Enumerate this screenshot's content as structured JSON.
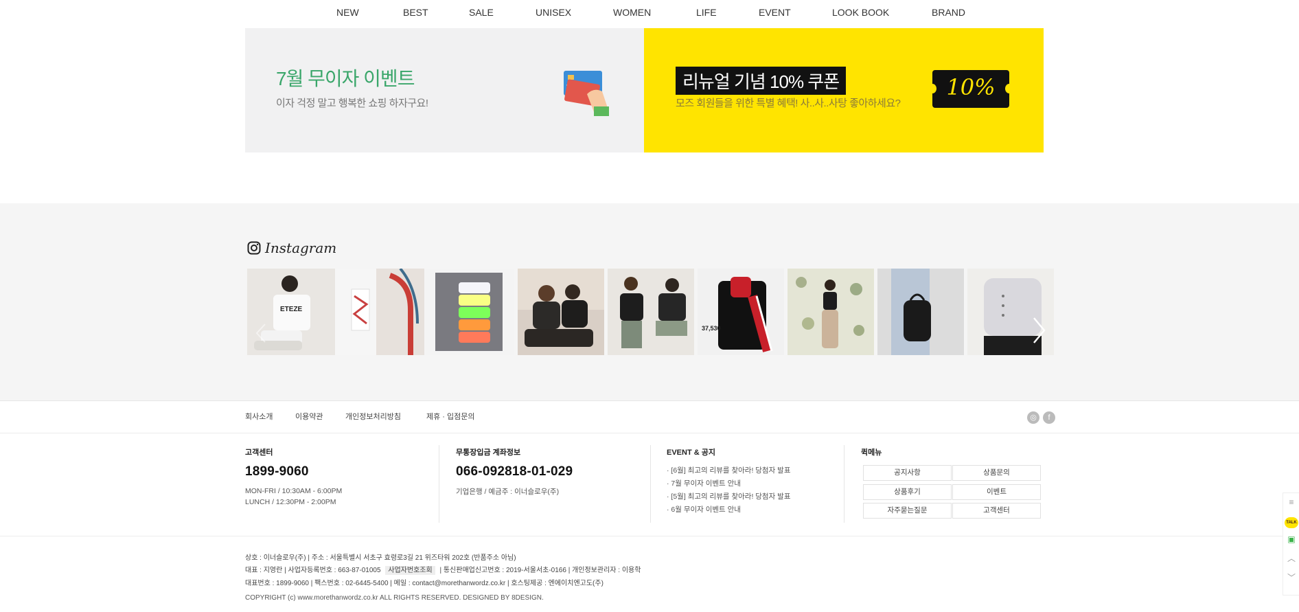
{
  "nav": {
    "items": [
      "NEW",
      "BEST",
      "SALE",
      "UNISEX",
      "WOMEN",
      "LIFE",
      "EVENT",
      "LOOK BOOK",
      "BRAND"
    ]
  },
  "banners": {
    "left": {
      "title": "7월 무이자 이벤트",
      "subtitle": "이자 걱정 말고 행복한 쇼핑 하자구요!",
      "bg": "#f1f1f2",
      "accent": "#3aa66a",
      "icon": "credit-card-icon"
    },
    "right": {
      "title": "리뉴얼 기념 10% 쿠폰",
      "subtitle": "모즈 회원들을 위한 특별 혜택! 사..사..사탕 좋아하세요?",
      "ticket_text": "10%",
      "bg": "#ffe400"
    }
  },
  "instagram": {
    "title": "Instagram",
    "icon": "instagram-icon",
    "thumbnails": [
      {
        "name": "insta-thumb-1",
        "alt": "ETEZE"
      },
      {
        "name": "insta-thumb-2",
        "alt": ""
      },
      {
        "name": "insta-thumb-3",
        "alt": ""
      },
      {
        "name": "insta-thumb-4",
        "alt": ""
      },
      {
        "name": "insta-thumb-5",
        "alt": ""
      },
      {
        "name": "insta-thumb-6",
        "alt": "37,530"
      },
      {
        "name": "insta-thumb-7",
        "alt": ""
      },
      {
        "name": "insta-thumb-8",
        "alt": ""
      },
      {
        "name": "insta-thumb-9",
        "alt": ""
      }
    ]
  },
  "footer": {
    "links": [
      "회사소개",
      "이용약관",
      "개인정보처리방침",
      "제휴 · 입점문의"
    ],
    "social": [
      "instagram-icon",
      "facebook-icon"
    ],
    "customer_center": {
      "title": "고객센터",
      "phone": "1899-9060",
      "hours": "MON-FRI / 10:30AM - 6:00PM",
      "lunch": "LUNCH / 12:30PM - 2:00PM"
    },
    "bank": {
      "title": "무통장입금 계좌정보",
      "account": "066-092818-01-029",
      "holder": "기업은행 / 예금주 : 이너슬로우(주)"
    },
    "event_notice": {
      "title": "EVENT & 공지",
      "items": [
        "· [6월] 최고의 리뷰를 찾아라! 당첨자 발표",
        "· 7월 무이자 이벤트 안내",
        "· [5월] 최고의 리뷰를 찾아라! 당첨자 발표",
        "· 6월 무이자 이벤트 안내"
      ]
    },
    "quick_menu": {
      "title": "퀵메뉴",
      "buttons": [
        "공지사항",
        "상품문의",
        "상품후기",
        "이벤트",
        "자주묻는질문",
        "고객센터"
      ]
    },
    "company": {
      "line1": "상호 : 이너슬로우(주)  |  주소 : 서울특별시 서초구 효령로3길 21 위즈타워 202호 (반품주소 아님)",
      "line2a": "대표 : 지영란  |  사업자등록번호 : 663-87-01005",
      "line2_btn": "사업자번호조회",
      "line2b": "|  통신판매업신고번호 : 2019-서울서초-0166  |  개인정보관리자 : 이용학",
      "line3": "대표번호 : 1899-9060  |  팩스번호 : 02-6445-5400  |  메일 : contact@morethanwordz.co.kr  |  호스팅제공 : 엔에이치엔고도(주)"
    },
    "copyright": "COPYRIGHT (c) www.morethanwordz.co.kr ALL RIGHTS RESERVED. DESIGNED BY 8DESIGN."
  },
  "sidebar": {
    "items": [
      "menu-icon",
      "kakao-talk-icon",
      "chat-icon",
      "scroll-up-icon",
      "scroll-down-icon"
    ],
    "talk_label": "TALK"
  }
}
